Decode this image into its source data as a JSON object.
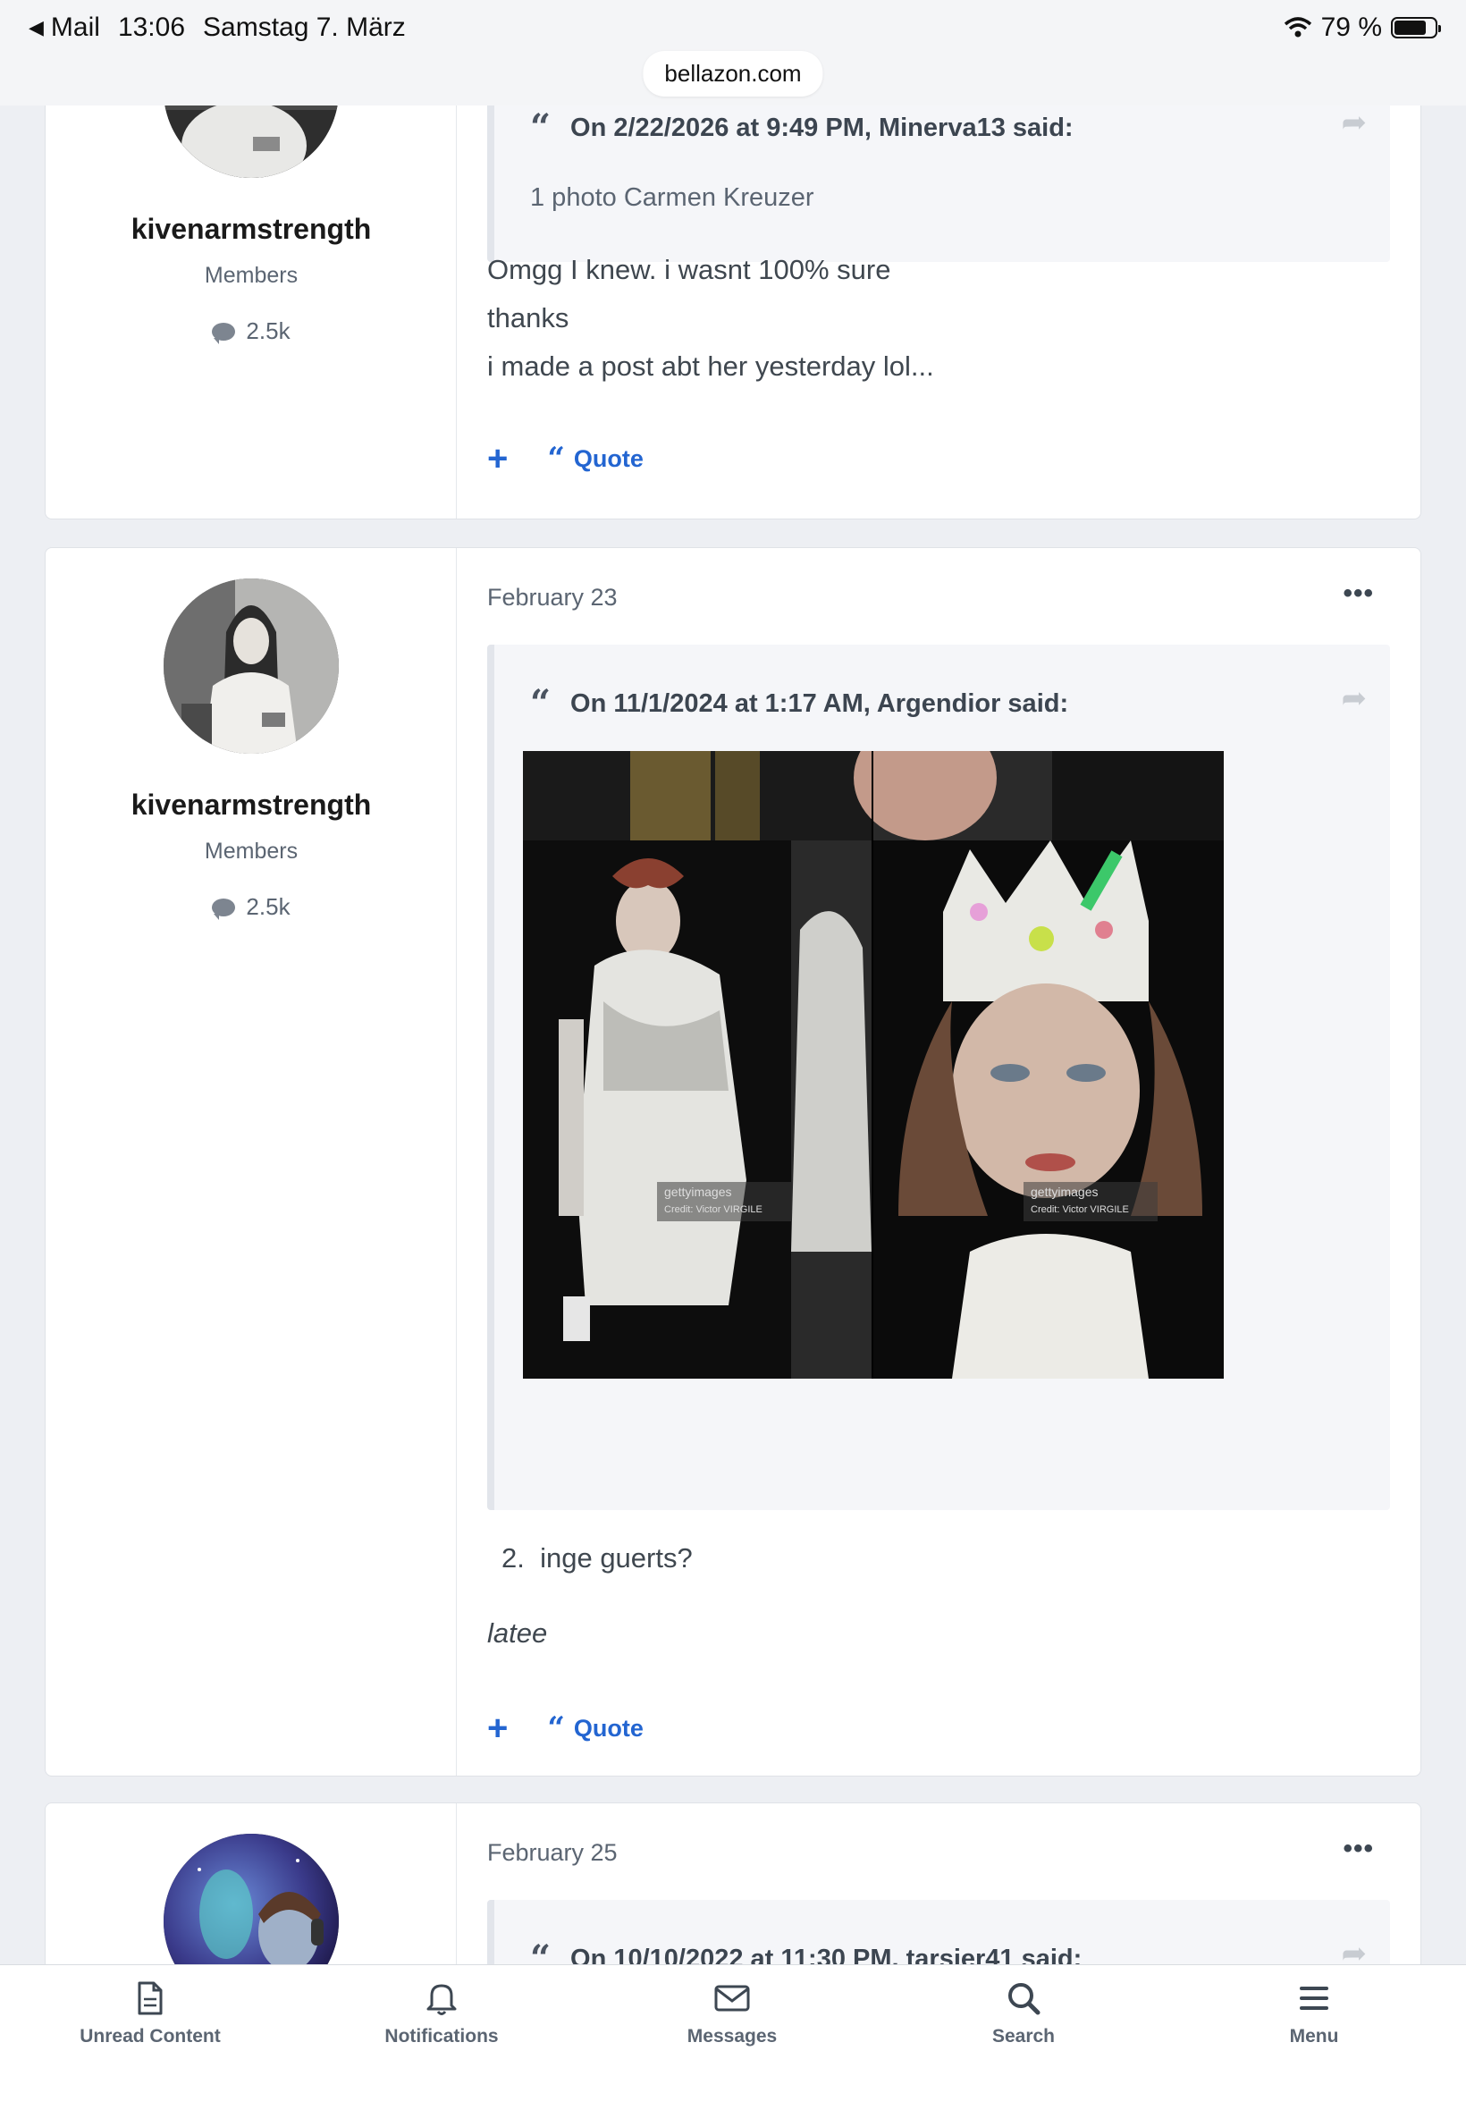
{
  "status_bar": {
    "back_app": "Mail",
    "time": "13:06",
    "date": "Samstag 7. März",
    "battery": "79 %",
    "battery_level": 0.79
  },
  "browser": {
    "url": "bellazon.com"
  },
  "posts": [
    {
      "author": {
        "name": "kivenarmstrength",
        "group": "Members",
        "post_count": "2.5k"
      },
      "quote": {
        "header": "On 2/22/2026 at 9:49 PM, Minerva13 said:",
        "text": "1 photo Carmen Kreuzer"
      },
      "body": [
        "Omgg I knew. i wasnt 100% sure",
        "thanks",
        "i made a post abt her yesterday lol..."
      ],
      "actions": {
        "quote_label": "Quote"
      }
    },
    {
      "date": "February 23",
      "author": {
        "name": "kivenarmstrength",
        "group": "Members",
        "post_count": "2.5k"
      },
      "quote": {
        "header": "On 11/1/2024 at 1:17 AM, Argendior said:"
      },
      "photo_watermarks": [
        "gettyimages",
        "Credit: Victor VIRGILE",
        "gettyimages",
        "Credit: Victor VIRGILE"
      ],
      "list_item": {
        "number": "2.",
        "text": "inge guerts?"
      },
      "italic_text": "latee",
      "actions": {
        "quote_label": "Quote"
      }
    },
    {
      "date": "February 25",
      "quote": {
        "header": "On 10/10/2022 at 11:30 PM, tarsier41 said:"
      }
    }
  ],
  "tab_bar": {
    "items": [
      {
        "label": "Unread Content",
        "icon": "document-icon"
      },
      {
        "label": "Notifications",
        "icon": "bell-icon"
      },
      {
        "label": "Messages",
        "icon": "envelope-icon"
      },
      {
        "label": "Search",
        "icon": "search-icon"
      },
      {
        "label": "Menu",
        "icon": "menu-icon"
      }
    ]
  }
}
